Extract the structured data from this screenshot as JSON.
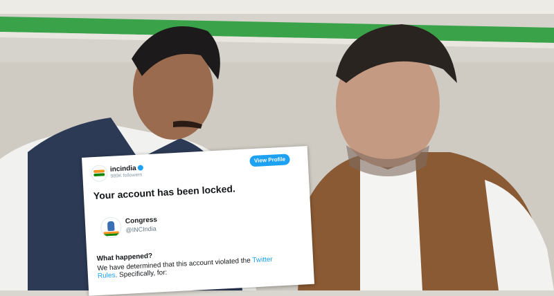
{
  "card": {
    "handle": "incindia",
    "followers": "989K followers",
    "view_profile": "View Profile",
    "headline": "Your account has been locked.",
    "account_name": "Congress",
    "account_handle": "@INCIndia",
    "question": "What happened?",
    "line1": "We have determined that this account violated the ",
    "link1": "Twitter",
    "link2": "Rules",
    "line2_rest": ". Specifically, for:"
  },
  "colors": {
    "accent": "#1da1f2",
    "saffron": "#f7931e",
    "green": "#138808"
  }
}
